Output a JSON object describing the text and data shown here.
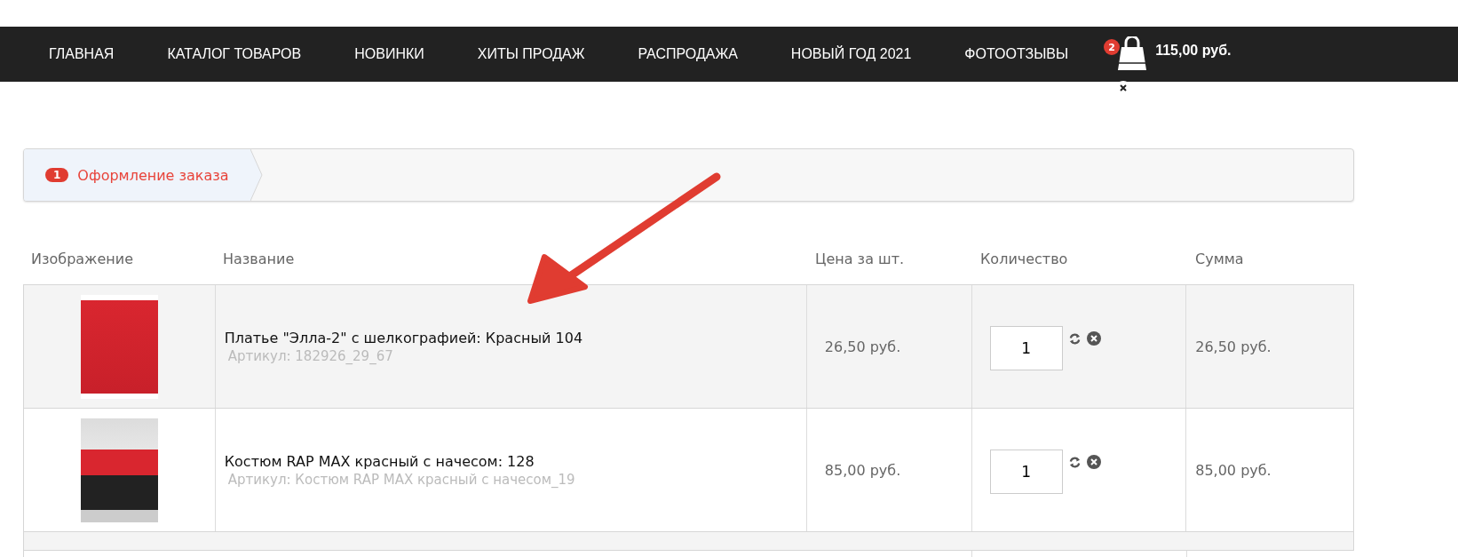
{
  "nav": {
    "items": [
      {
        "label": "ГЛАВНАЯ"
      },
      {
        "label": "КАТАЛОГ ТОВАРОВ"
      },
      {
        "label": "НОВИНКИ"
      },
      {
        "label": "ХИТЫ ПРОДАЖ"
      },
      {
        "label": "РАСПРОДАЖА"
      },
      {
        "label": "НОВЫЙ ГОД 2021"
      },
      {
        "label": "ФОТООТЗЫВЫ"
      }
    ],
    "cart": {
      "count": "2",
      "total": "115,00 руб."
    }
  },
  "steps": [
    {
      "number": "1",
      "label": "Оформление заказа",
      "selected": true
    }
  ],
  "table": {
    "columns": [
      "Изображение",
      "Название",
      "Цена за шт.",
      "Количество",
      "Сумма"
    ],
    "rows": [
      {
        "name": "Платье \"Элла-2\" с шелкографией: Красный 104",
        "article": "Артикул: 182926_29_67",
        "price": "26,50 руб.",
        "quantity": "1",
        "sum": "26,50 руб."
      },
      {
        "name": "Костюм RAP MAX красный с начесом: 128",
        "article": "Артикул: Костюм RAP MAX красный с начесом_19",
        "price": "85,00 руб.",
        "quantity": "1",
        "sum": "85,00 руб."
      }
    ]
  }
}
